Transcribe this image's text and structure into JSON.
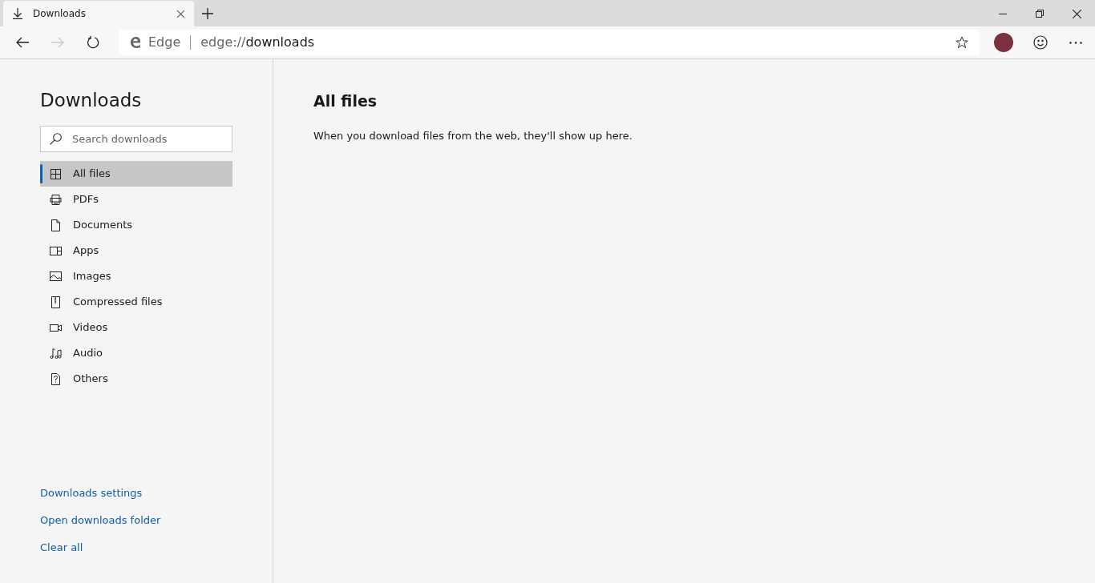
{
  "tabs": [
    {
      "label": "Downloads",
      "selected": true
    }
  ],
  "address_bar": {
    "site_label": "Edge",
    "url_prefix": "edge://",
    "url_host": "downloads"
  },
  "sidebar": {
    "title": "Downloads",
    "search": {
      "placeholder": "Search downloads"
    },
    "items": [
      {
        "label": "All files",
        "selected": true
      },
      {
        "label": "PDFs",
        "selected": false
      },
      {
        "label": "Documents",
        "selected": false
      },
      {
        "label": "Apps",
        "selected": false
      },
      {
        "label": "Images",
        "selected": false
      },
      {
        "label": "Compressed files",
        "selected": false
      },
      {
        "label": "Videos",
        "selected": false
      },
      {
        "label": "Audio",
        "selected": false
      },
      {
        "label": "Others",
        "selected": false
      }
    ],
    "links": [
      "Downloads settings",
      "Open downloads folder",
      "Clear all"
    ]
  },
  "main": {
    "heading": "All files",
    "message": "When you download files from the web, they'll show up here."
  }
}
